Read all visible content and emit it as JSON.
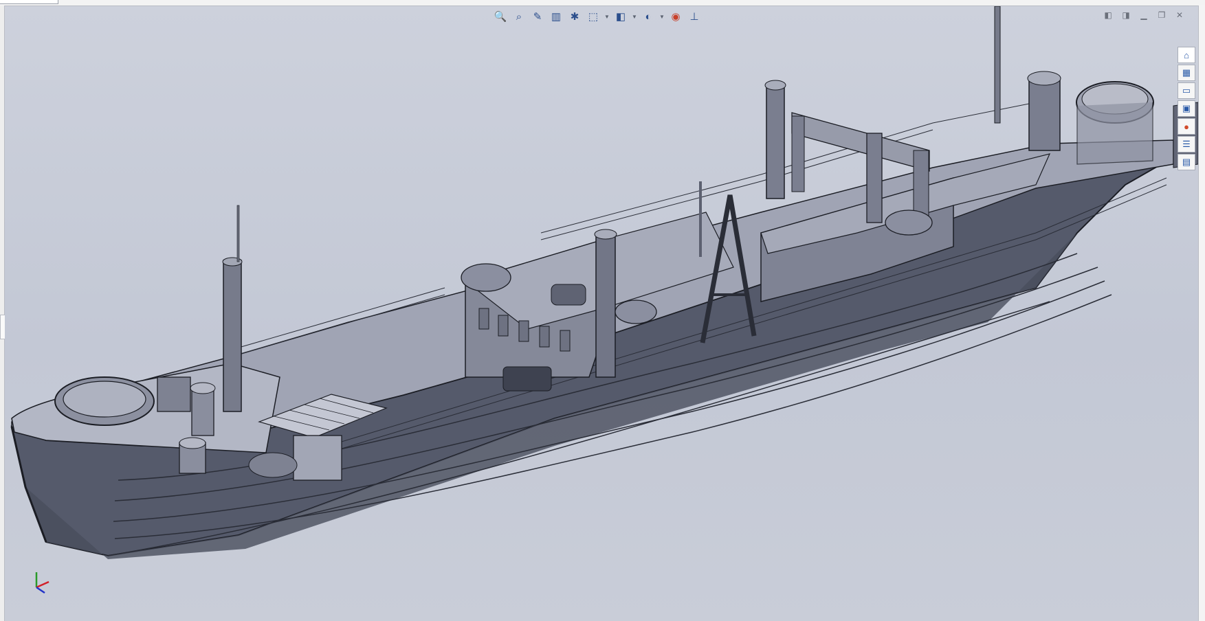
{
  "window": {
    "mode": "3D model viewport"
  },
  "heads_up_toolbar": [
    {
      "name": "zoom-to-fit",
      "icon": "zoom-fit-icon",
      "glyph": "🔍"
    },
    {
      "name": "zoom-to-area",
      "icon": "zoom-area-icon",
      "glyph": "⌕"
    },
    {
      "name": "previous-view",
      "icon": "previous-view-icon",
      "glyph": "✎"
    },
    {
      "name": "section-view",
      "icon": "section-view-icon",
      "glyph": "▥"
    },
    {
      "name": "dynamic-annotation-views",
      "icon": "annotation-icon",
      "glyph": "✱"
    },
    {
      "name": "view-orientation",
      "icon": "view-orientation-icon",
      "glyph": "⬚"
    },
    {
      "name": "display-style",
      "icon": "display-style-icon",
      "glyph": "◧"
    },
    {
      "name": "hide-show-items",
      "icon": "hide-show-icon",
      "glyph": "◐"
    },
    {
      "name": "edit-appearance",
      "icon": "appearance-icon",
      "glyph": "◉"
    },
    {
      "name": "apply-scene",
      "icon": "scene-icon",
      "glyph": "⊥"
    }
  ],
  "window_controls": [
    {
      "name": "tile-left",
      "glyph": "◧"
    },
    {
      "name": "tile-right",
      "glyph": "◨"
    },
    {
      "name": "minimize",
      "glyph": "▁"
    },
    {
      "name": "restore",
      "glyph": "❐"
    },
    {
      "name": "close",
      "glyph": "✕"
    }
  ],
  "task_pane": [
    {
      "name": "solidworks-resources",
      "icon": "home-icon",
      "glyph": "⌂"
    },
    {
      "name": "design-library",
      "icon": "library-icon",
      "glyph": "▦"
    },
    {
      "name": "file-explorer",
      "icon": "folder-icon",
      "glyph": "▭"
    },
    {
      "name": "view-palette",
      "icon": "view-palette-icon",
      "glyph": "▣"
    },
    {
      "name": "appearances-scenes",
      "icon": "appearances-icon",
      "glyph": "●"
    },
    {
      "name": "custom-properties",
      "icon": "properties-icon",
      "glyph": "☰"
    },
    {
      "name": "forum",
      "icon": "forum-icon",
      "glyph": "▤"
    }
  ],
  "colors": {
    "viewport_bg": "#c6cbd7",
    "hull_dark": "#4f5363",
    "hull_mid": "#5d6172",
    "deck": "#9a9eaf",
    "structure": "#7b7f90",
    "edge": "#1b1d24",
    "toolbar_icon": "#2b4e8c"
  },
  "triad": {
    "x_color": "#d2202a",
    "y_color": "#2a9a2a",
    "z_color": "#2233c8"
  }
}
